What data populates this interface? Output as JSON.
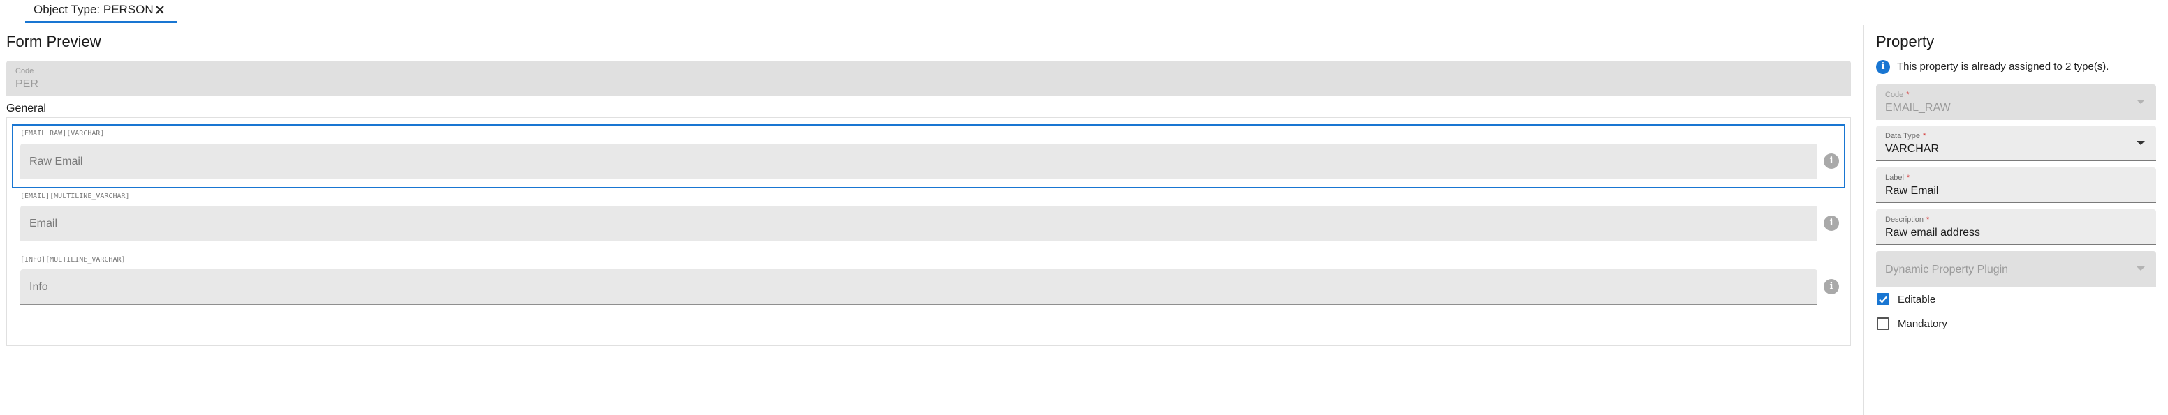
{
  "tab": {
    "label": "Object Type: PERSON",
    "close_icon": "close-icon"
  },
  "form_preview": {
    "title": "Form Preview",
    "code_field": {
      "label": "Code",
      "value": "PER"
    },
    "section": {
      "label": "General",
      "properties": [
        {
          "tag": "[EMAIL_RAW][VARCHAR]",
          "placeholder": "Raw Email",
          "selected": true,
          "icon": "info-icon"
        },
        {
          "tag": "[EMAIL][MULTILINE_VARCHAR]",
          "placeholder": "Email",
          "selected": false,
          "icon": "info-icon"
        },
        {
          "tag": "[INFO][MULTILINE_VARCHAR]",
          "placeholder": "Info",
          "selected": false,
          "icon": "info-icon"
        }
      ]
    }
  },
  "property_panel": {
    "title": "Property",
    "notice": {
      "icon": "info-icon",
      "text": "This property is already assigned to 2 type(s)."
    },
    "fields": {
      "code": {
        "label": "Code",
        "required": "*",
        "value": "EMAIL_RAW"
      },
      "data_type": {
        "label": "Data Type",
        "required": "*",
        "value": "VARCHAR"
      },
      "label": {
        "label": "Label",
        "required": "*",
        "value": "Raw Email"
      },
      "description": {
        "label": "Description",
        "required": "*",
        "value": "Raw email address"
      },
      "plugin": {
        "placeholder": "Dynamic Property Plugin"
      }
    },
    "checkboxes": {
      "editable": {
        "label": "Editable",
        "checked": true
      },
      "mandatory": {
        "label": "Mandatory",
        "checked": false
      }
    }
  },
  "colors": {
    "accent": "#1976d2",
    "required": "#d32f2f",
    "disabled_fill": "#e0e0e0"
  }
}
